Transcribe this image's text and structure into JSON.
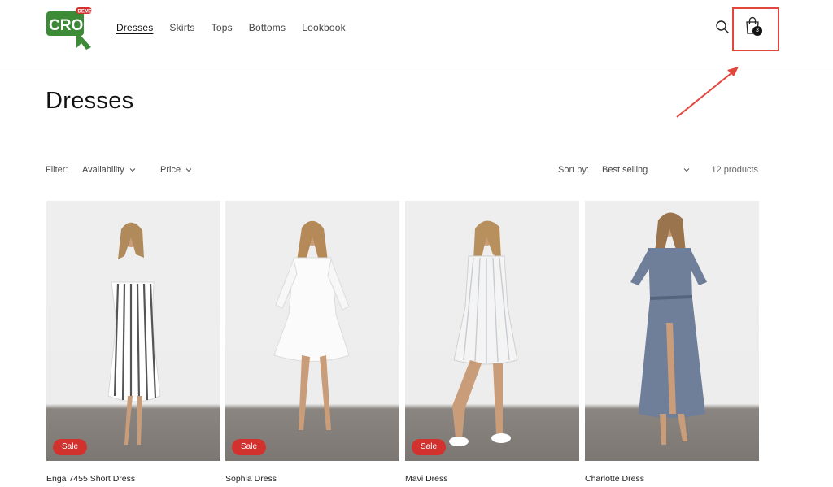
{
  "brand": {
    "logo_text": "CRO",
    "logo_tag": "DEMO",
    "colors": {
      "logo_green": "#3d8b37",
      "tag_red": "#d2322d",
      "annotation_red": "#e2463c",
      "sale_red": "#d2322d"
    }
  },
  "nav": {
    "items": [
      {
        "label": "Dresses",
        "active": true
      },
      {
        "label": "Skirts",
        "active": false
      },
      {
        "label": "Tops",
        "active": false
      },
      {
        "label": "Bottoms",
        "active": false
      },
      {
        "label": "Lookbook",
        "active": false
      }
    ]
  },
  "header_icons": {
    "search": "search-icon",
    "cart": "cart-icon",
    "cart_count": "3"
  },
  "page": {
    "title": "Dresses"
  },
  "filters": {
    "label": "Filter:",
    "availability": "Availability",
    "price": "Price",
    "sort_label": "Sort by:",
    "sort_value": "Best selling",
    "product_count": "12 products"
  },
  "products": [
    {
      "name": "Enga 7455 Short Dress",
      "badge": "Sale"
    },
    {
      "name": "Sophia Dress",
      "badge": "Sale"
    },
    {
      "name": "Mavi Dress",
      "badge": "Sale"
    },
    {
      "name": "Charlotte Dress",
      "badge": ""
    }
  ]
}
